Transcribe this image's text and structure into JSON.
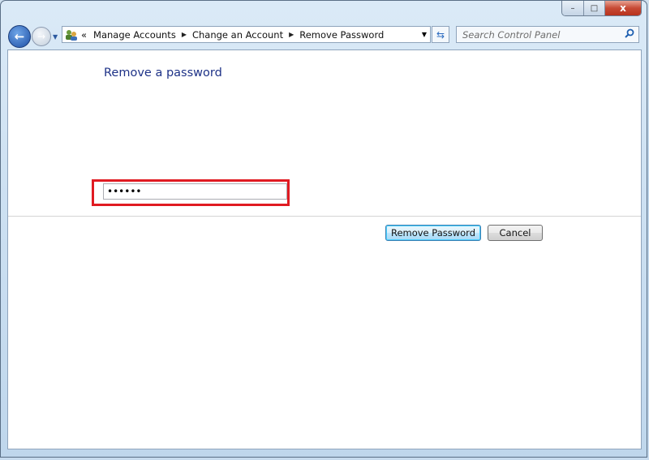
{
  "window": {
    "minimize": "–",
    "maximize": "□",
    "close": "x"
  },
  "nav": {
    "back_icon": "back-arrow-icon",
    "forward_icon": "forward-arrow-icon"
  },
  "address_bar": {
    "overflow": "«",
    "breadcrumbs": [
      "Manage Accounts",
      "Change an Account",
      "Remove Password"
    ]
  },
  "search": {
    "placeholder": "Search Control Panel"
  },
  "main": {
    "title": "Remove a password",
    "password_value": "••••••",
    "highlight_color": "#e01b22",
    "remove_button": "Remove Password",
    "cancel_button": "Cancel"
  }
}
